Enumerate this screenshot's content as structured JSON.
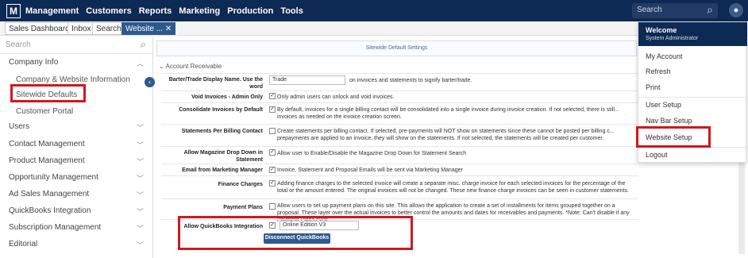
{
  "topnav": {
    "logo": "M",
    "items": [
      "Management",
      "Customers",
      "Reports",
      "Marketing",
      "Production",
      "Tools"
    ],
    "search_placeholder": "Search"
  },
  "tabs": [
    "Sales Dashboard",
    "Inbox",
    "Search",
    "Website ..."
  ],
  "sidebar": {
    "search_placeholder": "Search",
    "company_info": "Company Info",
    "sub_items": [
      "Company & Website Information",
      "Sitewide Defaults",
      "Customer Portal"
    ],
    "items": [
      "Users",
      "Contact Management",
      "Product Management",
      "Opportunity Management",
      "Ad Sales Management",
      "QuickBooks Integration",
      "Subscription Management",
      "Editorial"
    ]
  },
  "content": {
    "header": "Sitewide Default Settings",
    "section": "Account Receivable",
    "rows": [
      {
        "label": "Barter/Trade Display Name. Use the word",
        "value": "Trade",
        "text": "on invoices and statements to signify barter/trade."
      },
      {
        "label": "Void Invoices - Admin Only",
        "text": "Only admin users can unlock and void invoices."
      },
      {
        "label": "Consolidate Invoices by Default",
        "text": "By default, invoices for a single billing contact will be consolidated into a single invoice during invoice creation. If not selected, there is still... invoices as needed on the invoice creation screen."
      },
      {
        "label": "Statements Per Billing Contact",
        "text": "Create statements per billing contact. If selected, pre-payments will NOT show on statements since these cannot be posted per billing c... prepayments are applied to an invoice, they will show on the statements. If not selected, the statements will be created per customer."
      },
      {
        "label": "Allow Magazine Drop Down in Statement",
        "text": "Allow user to Enable/Disable the Magazine Drop Down for Statement Search"
      },
      {
        "label": "Email from Marketing Manager",
        "text": "Invoice, Statement and Proposal Emails will be sent via Marketing Manager"
      },
      {
        "label": "Finance Charges",
        "text": "Adding finance charges to the selected invoice will create a separate misc. charge invoice for each selected invoices for the percentage of the total or the amount entered. The original invoices will not be changed. These new finance charge invoices can be seen in customer statements."
      },
      {
        "label": "Payment Plans",
        "text": "Allow users to set up payment plans on this site. This allows the application to create a set of installments for items grouped together on a proposal. These layer over the actual invoices to better control the amounts and dates for receivables and payments. *Note: Can't disable if any Payment Plans exist."
      },
      {
        "label": "Allow QuickBooks Integration",
        "value": "Online Edition V3",
        "button": "Disconnect QuickBooks"
      }
    ]
  },
  "dropdown": {
    "welcome": "Welcome",
    "role": "System Administrator",
    "items": [
      "My Account",
      "Refresh",
      "Print",
      "User Setup",
      "Nav Bar Setup",
      "Website Setup",
      "Logout"
    ]
  }
}
